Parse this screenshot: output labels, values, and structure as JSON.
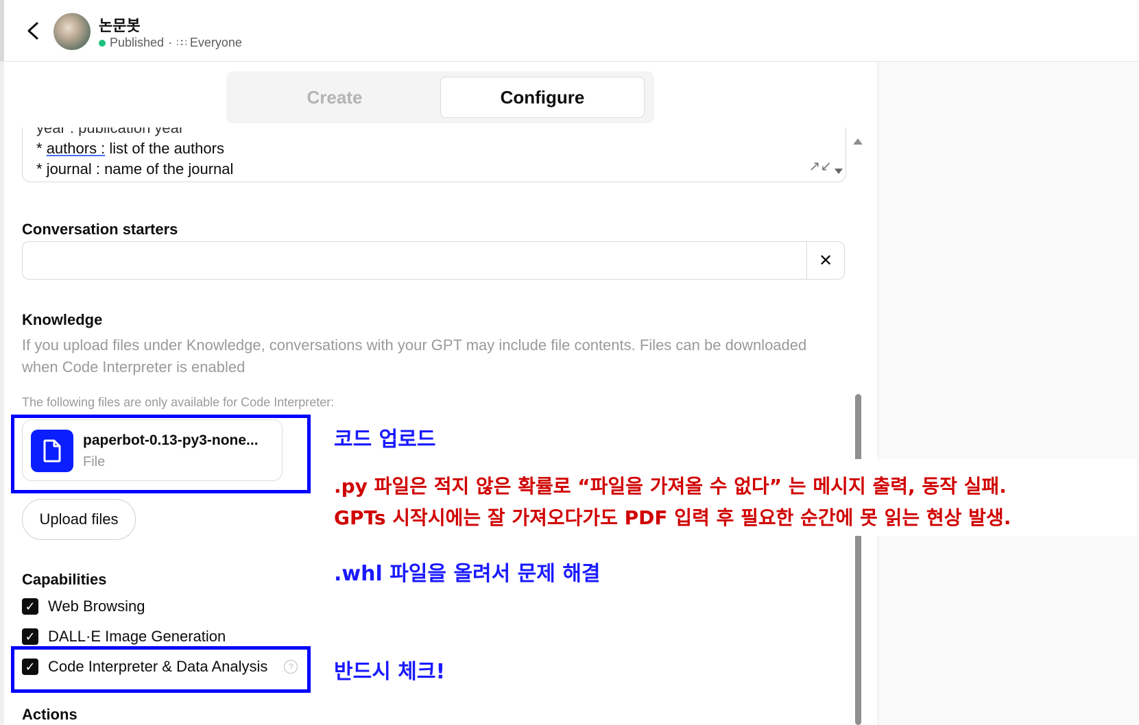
{
  "header": {
    "gpt_name": "논문봇",
    "status": "Published",
    "separator": "·",
    "visibility": "Everyone"
  },
  "tabs": [
    {
      "label": "Create",
      "active": false
    },
    {
      "label": "Configure",
      "active": true
    }
  ],
  "instructions": {
    "line_partial": "year : publication year",
    "line1_key": "authors :",
    "line1_rest": " list of the authors",
    "line2": "journal : name of the journal",
    "bullet": "*"
  },
  "conversation_starters": {
    "label": "Conversation starters",
    "value": "",
    "clear_icon": "✕"
  },
  "knowledge": {
    "label": "Knowledge",
    "help": "If you upload files under Knowledge, conversations with your GPT may include file contents. Files can be downloaded when Code Interpreter is enabled",
    "files_note": "The following files are only available for Code Interpreter:",
    "file": {
      "name": "paperbot-0.13-py3-none...",
      "type": "File"
    },
    "upload_label": "Upload files"
  },
  "capabilities": {
    "label": "Capabilities",
    "items": [
      {
        "label": "Web Browsing",
        "checked": true
      },
      {
        "label": "DALL·E Image Generation",
        "checked": true
      },
      {
        "label": "Code Interpreter & Data Analysis",
        "checked": true
      }
    ],
    "help_icon": "?"
  },
  "actions": {
    "label": "Actions"
  },
  "annotations": {
    "code_upload": "코드 업로드",
    "issue_line1": ".py 파일은 적지 않은 확률로 “파일을 가져올 수 없다” 는 메시지 출력, 동작 실패.",
    "issue_line2": "GPTs 시작시에는 잘 가져오다가도 PDF 입력 후 필요한 순간에 못 읽는 현상 발생.",
    "fix": ".whl 파일을 올려서 문제 해결",
    "must_check": "반드시 체크!",
    "box_color": "#0000ff",
    "blue_text_color": "#1a1aff",
    "red_text_color": "#d00000"
  }
}
